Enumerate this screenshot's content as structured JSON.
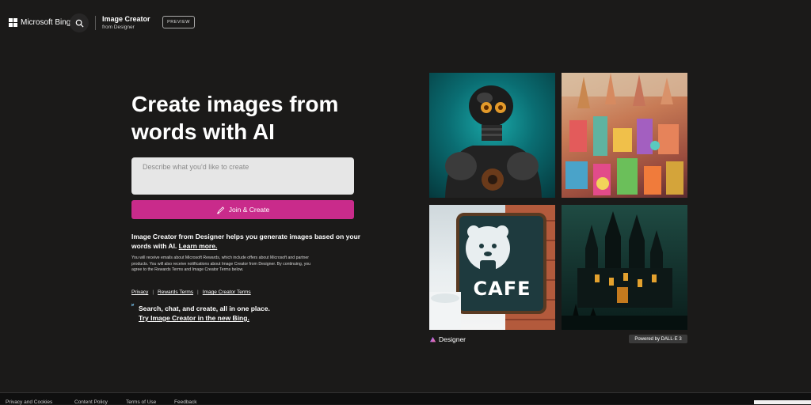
{
  "header": {
    "brand": "Microsoft Bing",
    "app_title": "Image Creator",
    "app_subtitle": "from Designer",
    "badge": "PREVIEW"
  },
  "hero": {
    "title": "Create images from words with AI",
    "prompt_placeholder": "Describe what you'd like to create",
    "join_button": "Join & Create",
    "description": "Image Creator from Designer helps you generate images based on your words with AI.",
    "learn_more": "Learn more.",
    "fine_print": "You will receive emails about Microsoft Rewards, which include offers about Microsoft and partner products. You will also receive notifications about Image Creator from Designer. By continuing, you agree to the Rewards Terms and Image Creator Terms below.",
    "links": [
      "Privacy",
      "Rewards Terms",
      "Image Creator Terms"
    ],
    "new_bing_line1": "Search, chat, and create, all in one place.",
    "new_bing_line2": "Try Image Creator in the new Bing."
  },
  "gallery": {
    "cafe_sign": "CAFE",
    "designer_label": "Designer",
    "powered_by": "Powered by DALL·E 3"
  },
  "footer": {
    "items": [
      "Privacy and Cookies",
      "Content Policy",
      "Terms of Use",
      "Feedback"
    ]
  },
  "colors": {
    "background": "#1b1a19",
    "accent": "#c92b8b",
    "input_bg": "#e6e6e6"
  }
}
